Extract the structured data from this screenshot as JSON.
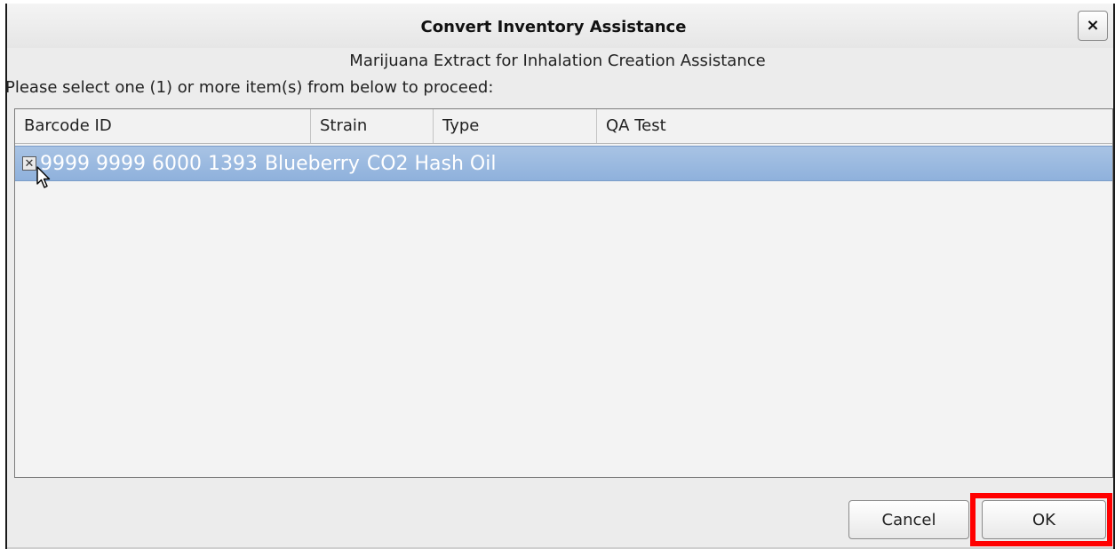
{
  "dialog": {
    "title": "Convert Inventory Assistance",
    "close_label": "×",
    "subtitle": "Marijuana Extract for Inhalation Creation Assistance",
    "instructions": "Please select one (1) or more item(s) from below to proceed:"
  },
  "table": {
    "columns": [
      "Barcode ID",
      "Strain",
      "Type",
      "QA Test"
    ],
    "rows": [
      {
        "checked": true,
        "checkbox_glyph": "✕",
        "barcode": "9999 9999 6000 1393",
        "strain": "Blueberry",
        "type": "CO2 Hash Oil",
        "qa_test": ""
      }
    ]
  },
  "buttons": {
    "cancel_label": "Cancel",
    "ok_label": "OK"
  },
  "colors": {
    "selected_row": "#98b8de",
    "highlight": "#ff0000",
    "dialog_bg": "#ececec"
  },
  "icons": {
    "close": "close-icon",
    "cursor": "mouse-pointer-icon",
    "checkbox": "checkbox-checked-icon"
  }
}
